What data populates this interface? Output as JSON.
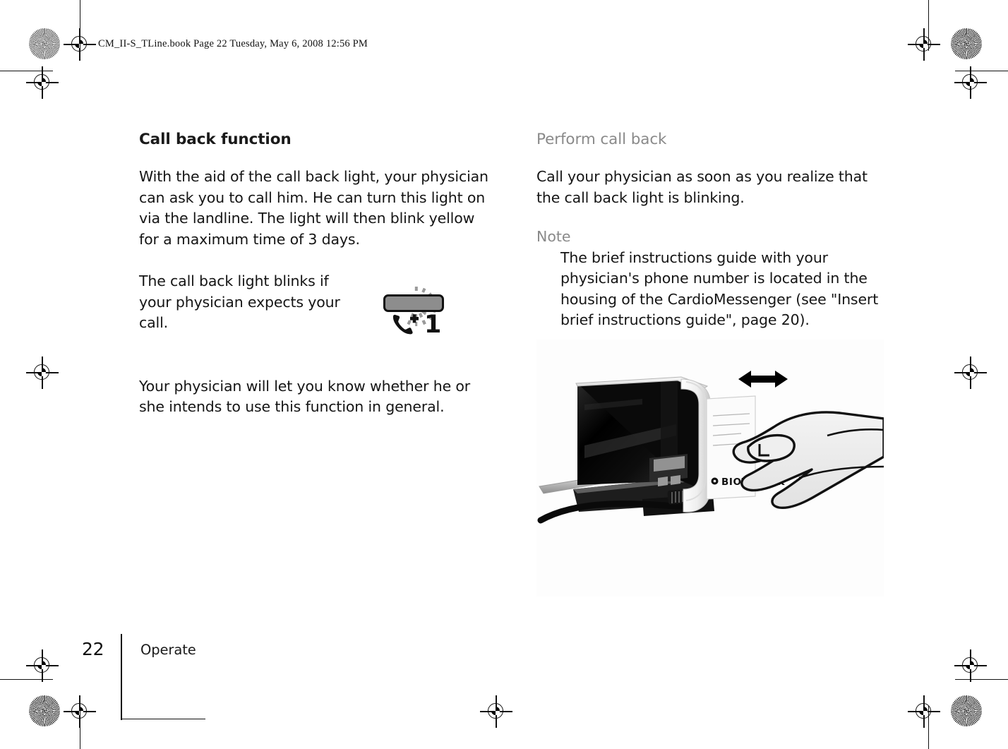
{
  "print_slug": "CM_II-S_TLine.book  Page 22  Tuesday, May 6, 2008  12:56 PM",
  "left_column": {
    "heading": "Call back function",
    "paragraph_1": "With the aid of the call back light, your physician can ask you to call him. He can turn this light on via the landline. The light will then blink yellow for a maximum time of 3 days.",
    "paragraph_2": "The call back light blinks if your physician expects your call.",
    "paragraph_3": "Your physician will let you know whether he or she intends to use this function in general.",
    "blink_icon": {
      "name": "call-back-light-blinking",
      "digit": "1",
      "led_color": "#8d8d8d",
      "ray_color": "#9a9a9a"
    }
  },
  "right_column": {
    "heading": "Perform call back",
    "heading_color": "#8a8a8a",
    "paragraph_1": "Call your physician as soon as you realize that the call back light is blinking.",
    "note_label": "Note",
    "note_text": "The brief instructions guide with your physician's phone number is located in the housing of the CardioMessenger (see \"Insert brief instructions guide\", page   20)."
  },
  "illustration": {
    "caption_arrow": "double-headed-horizontal-arrow",
    "brand_label": "BIOTRONIK",
    "device": "CardioMessenger",
    "card": "brief-instructions-guide"
  },
  "footer": {
    "page_number": "22",
    "running_head": "Operate"
  }
}
